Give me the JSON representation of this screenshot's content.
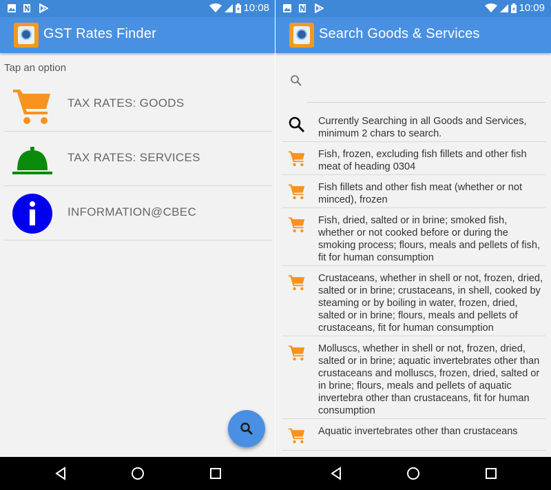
{
  "left_screen": {
    "status_time": "10:08",
    "app_title": "GST Rates Finder",
    "subheading": "Tap an option",
    "menu_items": [
      {
        "label": "TAX RATES: GOODS",
        "icon": "cart-icon",
        "icon_color": "#f7931e"
      },
      {
        "label": "TAX RATES: SERVICES",
        "icon": "service-bell-icon",
        "icon_color": "#0a8a0a"
      },
      {
        "label": "INFORMATION@CBEC",
        "icon": "info-icon",
        "icon_color": "#0000ee"
      }
    ],
    "fab_icon": "search-icon"
  },
  "right_screen": {
    "status_time": "10:09",
    "app_title": "Search Goods & Services",
    "search_placeholder": "",
    "results": [
      {
        "text": "Currently Searching in all Goods and Services, minimum 2 chars to search.",
        "icon": "search-icon"
      },
      {
        "text": "Fish, frozen, excluding fish fillets and other fish meat of heading 0304",
        "icon": "cart-icon"
      },
      {
        "text": "Fish fillets and other fish meat (whether or not minced), frozen",
        "icon": "cart-icon"
      },
      {
        "text": "Fish, dried, salted or in brine; smoked fish, whether or not cooked before or during the smoking process; flours, meals and pellets of fish, fit for human consumption",
        "icon": "cart-icon"
      },
      {
        "text": "Crustaceans, whether in shell or not, frozen, dried, salted or in brine; crustaceans, in shell, cooked by steaming or by boiling in water, frozen, dried, salted or in brine; flours, meals and pellets of crustaceans, fit for human consumption",
        "icon": "cart-icon"
      },
      {
        "text": "Molluscs, whether in shell or not, frozen, dried, salted or in brine; aquatic invertebrates other than crustaceans and molluscs, frozen, dried, salted or in brine; flours, meals and pellets of aquatic invertebra other than crustaceans, fit for human consumption",
        "icon": "cart-icon"
      },
      {
        "text": "Aquatic invertebrates other than crustaceans",
        "icon": "cart-icon"
      }
    ]
  },
  "colors": {
    "appbar": "#4a90e2",
    "statusbar": "#3f88d8",
    "cart": "#f7931e",
    "fab": "#4a90e2"
  },
  "navbar": {
    "buttons": [
      "back-icon",
      "home-icon",
      "recents-icon"
    ]
  }
}
